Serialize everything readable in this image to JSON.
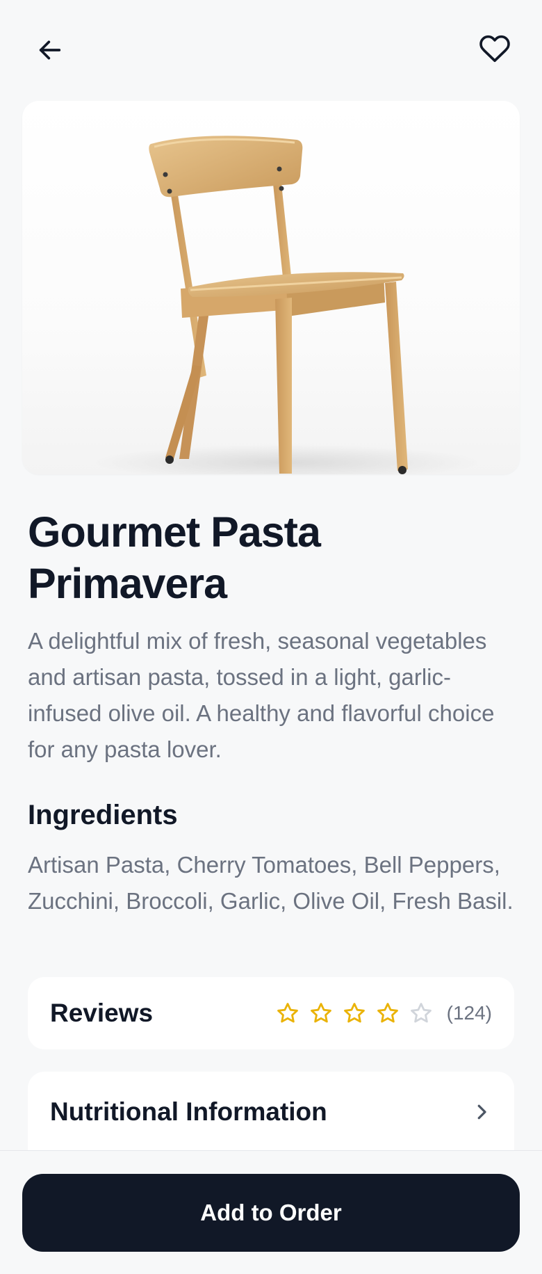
{
  "header": {
    "back_icon": "arrow-left-icon",
    "favorite_icon": "heart-icon"
  },
  "product": {
    "image_alt": "product-photo",
    "title": "Gourmet Pasta Primavera",
    "description": "A delightful mix of fresh, seasonal vegetables and artisan pasta, tossed in a light, garlic-infused olive oil. A healthy and flavorful choice for any pasta lover."
  },
  "ingredients": {
    "heading": "Ingredients",
    "text": "Artisan Pasta, Cherry Tomatoes, Bell Peppers, Zucchini, Broccoli, Garlic, Olive Oil, Fresh Basil."
  },
  "reviews": {
    "label": "Reviews",
    "rating": 4,
    "max_rating": 5,
    "count": "(124)",
    "star_color": "#eab308",
    "star_empty_color": "#d1d5db"
  },
  "nutrition": {
    "label": "Nutritional Information",
    "icon": "chevron-right-icon"
  },
  "footer": {
    "cta_label": "Add to Order"
  },
  "colors": {
    "background": "#f7f8f9",
    "primary": "#111827",
    "muted_text": "#6b7280"
  }
}
